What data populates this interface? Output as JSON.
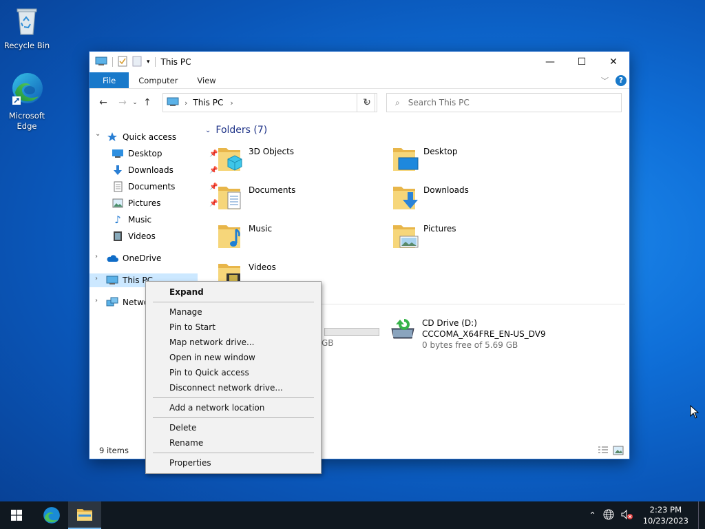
{
  "desktop": {
    "icons": [
      {
        "label": "Recycle Bin",
        "icon": "recycle-bin-icon"
      },
      {
        "label": "Microsoft Edge",
        "icon": "edge-icon"
      }
    ]
  },
  "window": {
    "title": "This PC",
    "ribbon_tabs": [
      "File",
      "Computer",
      "View"
    ],
    "address": "This PC",
    "search_placeholder": "Search This PC",
    "status": "9 items"
  },
  "nav": {
    "quick_access": "Quick access",
    "quick_items": [
      "Desktop",
      "Downloads",
      "Documents",
      "Pictures",
      "Music",
      "Videos"
    ],
    "onedrive": "OneDrive",
    "this_pc": "This PC",
    "network": "Network"
  },
  "content": {
    "folders_header": "Folders (7)",
    "folders": [
      "3D Objects",
      "Desktop",
      "Documents",
      "Downloads",
      "Music",
      "Pictures",
      "Videos"
    ],
    "partial_drive_size": "GB",
    "cd_drive": {
      "name": "CD Drive (D:)",
      "label": "CCCOMA_X64FRE_EN-US_DV9",
      "free": "0 bytes free of 5.69 GB"
    }
  },
  "context_menu": {
    "items": [
      "Expand",
      "Manage",
      "Pin to Start",
      "Map network drive...",
      "Open in new window",
      "Pin to Quick access",
      "Disconnect network drive...",
      "Add a network location",
      "Delete",
      "Rename",
      "Properties"
    ]
  },
  "taskbar": {
    "time": "2:23 PM",
    "date": "10/23/2023"
  },
  "colors": {
    "accent": "#1979ca",
    "selection": "#cce8ff",
    "taskbar": "#101820",
    "group_header": "#1e3287"
  }
}
